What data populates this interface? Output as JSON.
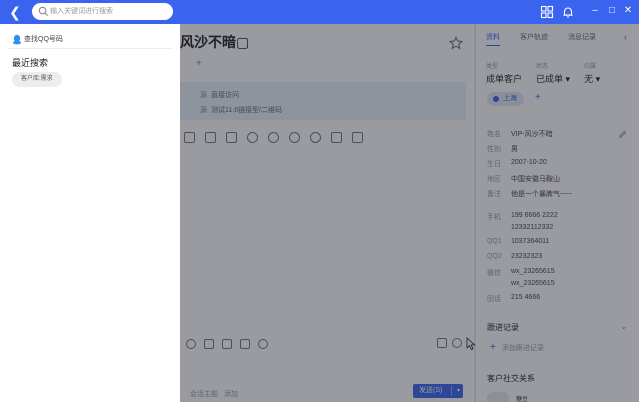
{
  "search": {
    "placeholder": "输入关键词进行搜索"
  },
  "dropdown": {
    "qq_search_label": "查找QQ号码",
    "recent_title": "最近搜索",
    "recent_items": [
      "客户库:需求"
    ]
  },
  "chat": {
    "title": "风沙不暗",
    "info_lines": [
      {
        "key": "源",
        "value": "直接访问"
      },
      {
        "key": "源",
        "value": "测试11.6链接型/二维码"
      }
    ],
    "bottom_hint": "会话主题",
    "bottom_hint_action": "添加",
    "send_label": "发送(S)"
  },
  "right_panel": {
    "tabs": [
      "资料",
      "客户轨迹",
      "消息记录"
    ],
    "status": [
      {
        "label": "类型",
        "value": "成单客户"
      },
      {
        "label": "状态",
        "value": "已成单"
      },
      {
        "label": "归属",
        "value": "无"
      }
    ],
    "tag": "上海",
    "fields": [
      {
        "label": "姓名",
        "value": "VIP-风沙不暗"
      },
      {
        "label": "性别",
        "value": "男"
      },
      {
        "label": "生日",
        "value": "2007-10-20"
      },
      {
        "label": "地区",
        "value": "中国安徽马鞍山"
      },
      {
        "label": "备注",
        "value": "他是一个暴脾气~~~"
      },
      {
        "label": "手机",
        "value": "199 6666 2222"
      },
      {
        "label": "",
        "value": "12332112332"
      },
      {
        "label": "QQ1",
        "value": "1037364011"
      },
      {
        "label": "QQ2",
        "value": "23232323"
      },
      {
        "label": "微信",
        "value": "wx_23265615"
      },
      {
        "label": "",
        "value": "wx_23265615"
      },
      {
        "label": "固话",
        "value": "215 4666"
      }
    ],
    "follow_title": "跟进记录",
    "follow_add": "添加跟进记录",
    "social_title": "客户社交关系",
    "social_name": "糖豆"
  },
  "colors": {
    "accent": "#3a64f0",
    "overlay": "rgba(32,34,44,0.45)"
  }
}
